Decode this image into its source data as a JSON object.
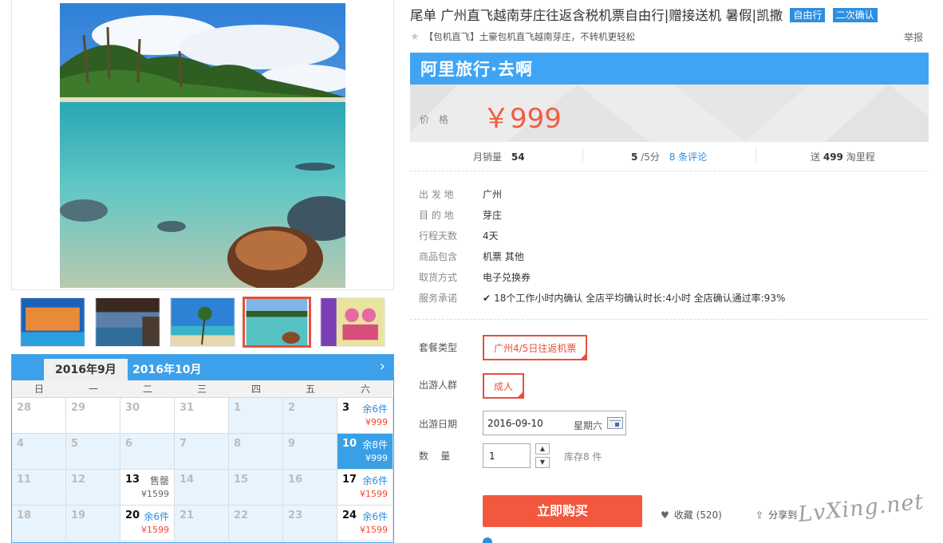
{
  "product": {
    "title": "尾单 广州直飞越南芽庄往返含税机票自由行|赠接送机 暑假|凯撒",
    "tags": [
      "自由行",
      "二次确认"
    ],
    "subtitle": "【包机直飞】土豪包机直飞越南芽庄，不转机更轻松",
    "report": "举报"
  },
  "banner": {
    "text": "阿里旅行·去啊",
    "color": "#3fa4f4"
  },
  "price": {
    "label": "价格",
    "value": "￥999",
    "color": "#f25c43"
  },
  "stats": {
    "monthly_sales_label": "月销量",
    "monthly_sales": "54",
    "rating": "5",
    "rating_suffix": "/5分",
    "reviews": "8 条评论",
    "points_prefix": "送",
    "points": "499",
    "points_suffix": "淘里程"
  },
  "info": [
    {
      "key": "出 发 地",
      "value": "广州"
    },
    {
      "key": "目 的 地",
      "value": "芽庄"
    },
    {
      "key": "行程天数",
      "value": "4天"
    },
    {
      "key": "商品包含",
      "value": "机票  其他"
    },
    {
      "key": "取货方式",
      "value": "电子兑换券"
    },
    {
      "key": "服务承诺",
      "value": "18个工作小时内确认    全店平均确认时长:4小时    全店确认通过率:93%"
    }
  ],
  "options": {
    "package_label": "套餐类型",
    "package_value": "广州4/5日往返机票",
    "group_label": "出游人群",
    "group_value": "成人",
    "date_label": "出游日期",
    "date_value": "2016-09-10",
    "date_weekday": "星期六",
    "qty_label": "数    量",
    "qty_value": "1",
    "stock": "库存8 件"
  },
  "actions": {
    "buy": "立即购买",
    "favorite": "收藏 (520)",
    "share": "分享到"
  },
  "watermark": "LvXing.net",
  "calendar": {
    "tabs": [
      "2016年9月",
      "2016年10月"
    ],
    "weekdays": [
      "日",
      "一",
      "二",
      "三",
      "四",
      "五",
      "六"
    ],
    "rows": [
      [
        {
          "d": "28",
          "active": false,
          "white": true
        },
        {
          "d": "29",
          "active": false,
          "white": true
        },
        {
          "d": "30",
          "active": false,
          "white": true
        },
        {
          "d": "31",
          "active": false,
          "white": true
        },
        {
          "d": "1",
          "active": false
        },
        {
          "d": "2",
          "active": false
        },
        {
          "d": "3",
          "active": true,
          "stock": "余6件",
          "price": "¥999"
        }
      ],
      [
        {
          "d": "4",
          "active": false
        },
        {
          "d": "5",
          "active": false
        },
        {
          "d": "6",
          "active": false
        },
        {
          "d": "7",
          "active": false
        },
        {
          "d": "8",
          "active": false
        },
        {
          "d": "9",
          "active": false
        },
        {
          "d": "10",
          "active": true,
          "selected": true,
          "stock": "余8件",
          "price": "¥999"
        }
      ],
      [
        {
          "d": "11",
          "active": false
        },
        {
          "d": "12",
          "active": false
        },
        {
          "d": "13",
          "active": true,
          "soldout": true,
          "stock": "售罄",
          "price": "¥1599"
        },
        {
          "d": "14",
          "active": false
        },
        {
          "d": "15",
          "active": false
        },
        {
          "d": "16",
          "active": false
        },
        {
          "d": "17",
          "active": true,
          "stock": "余6件",
          "price": "¥1599"
        }
      ],
      [
        {
          "d": "18",
          "active": false
        },
        {
          "d": "19",
          "active": false
        },
        {
          "d": "20",
          "active": true,
          "stock": "余6件",
          "price": "¥1599"
        },
        {
          "d": "21",
          "active": false
        },
        {
          "d": "22",
          "active": false
        },
        {
          "d": "23",
          "active": false
        },
        {
          "d": "24",
          "active": true,
          "stock": "余6件",
          "price": "¥1599"
        }
      ]
    ]
  }
}
